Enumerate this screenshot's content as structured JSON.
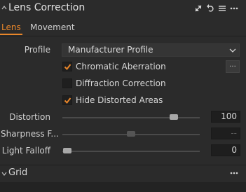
{
  "header": {
    "title": "Lens Correction",
    "icons": [
      "collapse-chevron-icon",
      "expand-arrows-icon",
      "reset-icon",
      "list-icon",
      "more-icon"
    ]
  },
  "tabs": [
    {
      "label": "Lens",
      "active": true
    },
    {
      "label": "Movement",
      "active": false
    }
  ],
  "profile": {
    "label": "Profile",
    "value": "Manufacturer Profile"
  },
  "checkboxes": [
    {
      "label": "Chromatic Aberration",
      "checked": true
    },
    {
      "label": "Diffraction Correction",
      "checked": false
    },
    {
      "label": "Hide Distorted Areas",
      "checked": true
    }
  ],
  "more_button": {
    "label": "..."
  },
  "sliders": [
    {
      "label": "Distortion",
      "value": "100",
      "level": 1.0,
      "enabled": true
    },
    {
      "label": "Sharpness F...",
      "value": "--",
      "level": 0.5,
      "enabled": false
    },
    {
      "label": "Light Falloff",
      "value": "0",
      "level": 0.0,
      "enabled": true
    }
  ],
  "grid_section": {
    "title": "Grid"
  },
  "colors": {
    "accent": "#e8862a",
    "background": "#2b2b2b",
    "field": "#1e1e1e"
  }
}
